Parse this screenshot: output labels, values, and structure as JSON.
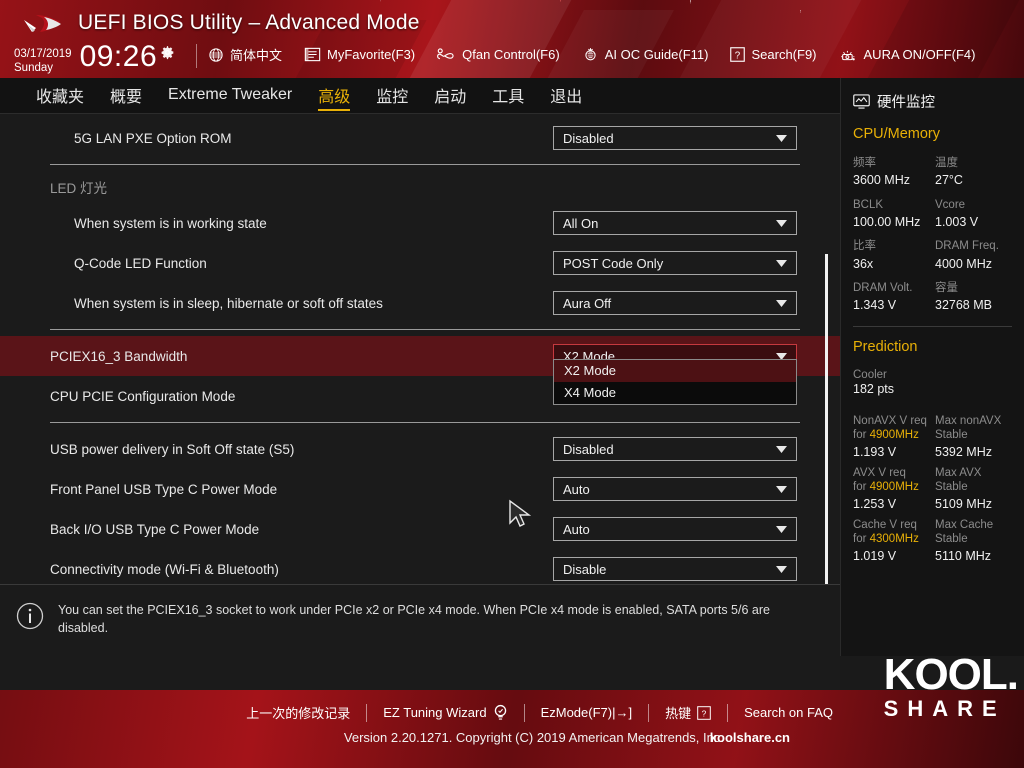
{
  "header": {
    "title": "UEFI BIOS Utility – Advanced Mode",
    "date": "03/17/2019",
    "weekday": "Sunday",
    "time": "09:26",
    "gear_icon": "gear-icon",
    "tools": [
      {
        "label": "简体中文",
        "icon": "globe-icon"
      },
      {
        "label": "MyFavorite(F3)",
        "icon": "list-icon"
      },
      {
        "label": "Qfan Control(F6)",
        "icon": "fan-icon"
      },
      {
        "label": "AI OC Guide(F11)",
        "icon": "brain-icon"
      },
      {
        "label": "Search(F9)",
        "icon": "question-box-icon"
      },
      {
        "label": "AURA ON/OFF(F4)",
        "icon": "aura-icon"
      }
    ]
  },
  "nav": {
    "tabs": [
      {
        "label": "收藏夹",
        "active": false
      },
      {
        "label": "概要",
        "active": false
      },
      {
        "label": "Extreme Tweaker",
        "active": false
      },
      {
        "label": "高级",
        "active": true
      },
      {
        "label": "监控",
        "active": false
      },
      {
        "label": "启动",
        "active": false
      },
      {
        "label": "工具",
        "active": false
      },
      {
        "label": "退出",
        "active": false
      }
    ],
    "active_color": "#e8b007"
  },
  "main": {
    "rows": [
      {
        "type": "setting",
        "label": "5G LAN PXE Option ROM",
        "indent": true,
        "value": "Disabled"
      },
      {
        "type": "divider"
      },
      {
        "type": "section",
        "label": "LED 灯光"
      },
      {
        "type": "setting",
        "label": "When system is in working state",
        "indent": true,
        "value": "All On"
      },
      {
        "type": "setting",
        "label": "Q-Code LED Function",
        "indent": true,
        "value": "POST Code Only"
      },
      {
        "type": "setting",
        "label": "When system is in sleep, hibernate or soft off states",
        "indent": true,
        "value": "Aura Off"
      },
      {
        "type": "divider"
      },
      {
        "type": "setting",
        "label": "PCIEX16_3 Bandwidth",
        "indent": false,
        "value": "X2 Mode",
        "selected": true,
        "open": true
      },
      {
        "type": "setting",
        "label": "CPU PCIE Configuration Mode",
        "indent": false,
        "value": ""
      },
      {
        "type": "divider"
      },
      {
        "type": "setting",
        "label": "USB power delivery in Soft Off state (S5)",
        "indent": false,
        "value": "Disabled"
      },
      {
        "type": "setting",
        "label": "Front Panel USB Type C Power Mode",
        "indent": false,
        "value": "Auto"
      },
      {
        "type": "setting",
        "label": "Back I/O USB Type C Power Mode",
        "indent": false,
        "value": "Auto"
      },
      {
        "type": "setting",
        "label": "Connectivity mode (Wi-Fi & Bluetooth)",
        "indent": false,
        "value": "Disable"
      }
    ],
    "dropdown": {
      "options": [
        {
          "label": "X2 Mode",
          "active": true
        },
        {
          "label": "X4 Mode",
          "active": false
        }
      ]
    },
    "highlight_color": "#5a1418"
  },
  "help": {
    "icon": "info-icon",
    "text": "You can set the PCIEX16_3 socket to work under PCIe x2 or PCIe x4 mode. When PCIe x4 mode is enabled, SATA ports 5/6 are disabled."
  },
  "sidebar": {
    "title": "硬件监控",
    "title_icon": "monitor-icon",
    "cpu_memory": {
      "heading": "CPU/Memory",
      "pairs": [
        {
          "k1": "频率",
          "v1": "3600 MHz",
          "k2": "温度",
          "v2": "27°C"
        },
        {
          "k1": "BCLK",
          "v1": "100.00 MHz",
          "k2": "Vcore",
          "v2": "1.003 V"
        },
        {
          "k1": "比率",
          "v1": "36x",
          "k2": "DRAM Freq.",
          "v2": "4000 MHz"
        },
        {
          "k1": "DRAM Volt.",
          "v1": "1.343 V",
          "k2": "容量",
          "v2": "32768 MB"
        }
      ]
    },
    "prediction": {
      "heading": "Prediction",
      "cooler_label": "Cooler",
      "cooler_value": "182 pts",
      "rows": [
        {
          "k1_line1": "NonAVX V req",
          "k1_line2_pre": "for ",
          "k1_line2_hl": "4900MHz",
          "v1": "1.193 V",
          "k2_line1": "Max nonAVX",
          "k2_line2": "Stable",
          "v2": "5392 MHz"
        },
        {
          "k1_line1": "AVX V req",
          "k1_line2_pre": "for ",
          "k1_line2_hl": "4900MHz",
          "v1": "1.253 V",
          "k2_line1": "Max AVX",
          "k2_line2": "Stable",
          "v2": "5109 MHz"
        },
        {
          "k1_line1": "Cache V req",
          "k1_line2_pre": "for ",
          "k1_line2_hl": "4300MHz",
          "v1": "1.019 V",
          "k2_line1": "Max Cache",
          "k2_line2": "Stable",
          "v2": "5110 MHz"
        }
      ]
    },
    "accent_color": "#e8b007"
  },
  "footer": {
    "links": [
      {
        "label": "上一次的修改记录",
        "icon": ""
      },
      {
        "label": "EZ Tuning Wizard",
        "icon": "bulb-icon"
      },
      {
        "label": "EzMode(F7)|→]",
        "icon": ""
      },
      {
        "label": "热键",
        "icon": "question-box-icon"
      },
      {
        "label": "Search on FAQ",
        "icon": ""
      }
    ],
    "version": "Version 2.20.1271. Copyright (C) 2019 American Megatrends, Inc.",
    "site_tag": "koolshare.cn"
  },
  "watermark": {
    "top": "KOOL.",
    "bottom": "SHARE"
  }
}
